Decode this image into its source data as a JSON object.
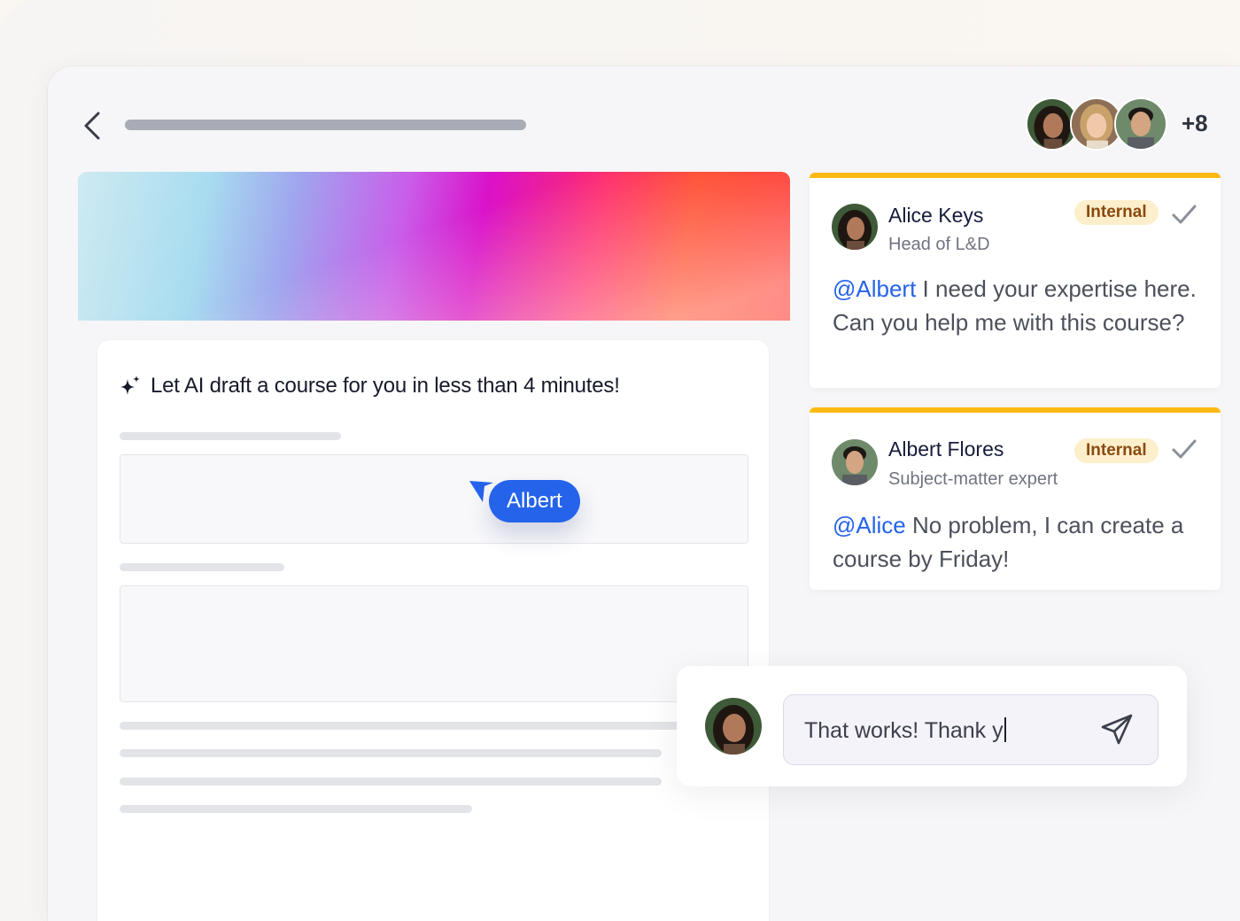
{
  "header": {
    "extra_collaborators": "+8"
  },
  "document": {
    "ai_prompt": "Let AI draft a course for you in less than 4 minutes!",
    "cursor_label": "Albert"
  },
  "comments": [
    {
      "name": "Alice Keys",
      "role": "Head of L&D",
      "badge": "Internal",
      "mention": "@Albert",
      "text": " I need your expertise here. Can you help me with this course?"
    },
    {
      "name": "Albert Flores",
      "role": "Subject-matter expert",
      "badge": "Internal",
      "mention": "@Alice",
      "text": " No problem, I can create a course by Friday!"
    }
  ],
  "reply": {
    "value": "That works! Thank y"
  },
  "colors": {
    "accent": "#2563eb",
    "comment_border": "#fcbb14",
    "badge_bg": "#fdefcc",
    "badge_text": "#8b4a10"
  }
}
